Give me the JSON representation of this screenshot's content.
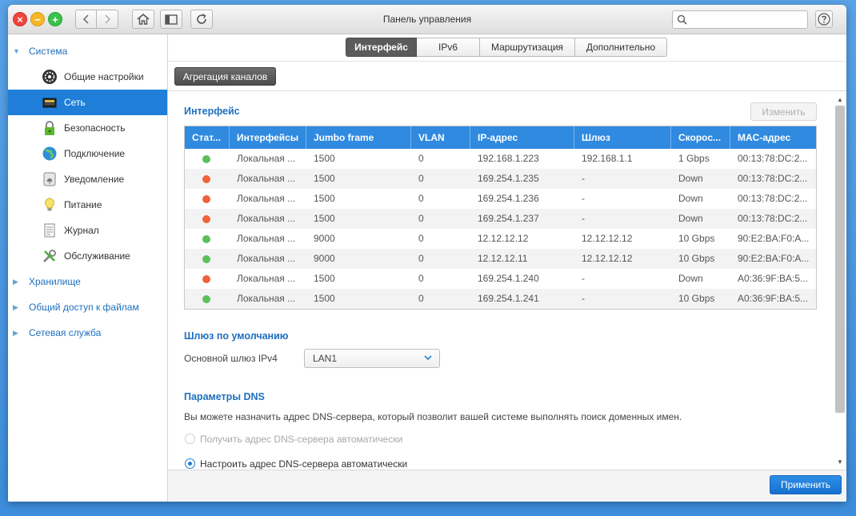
{
  "window": {
    "title": "Панель управления"
  },
  "search": {
    "placeholder": ""
  },
  "sidebar": {
    "system_label": "Система",
    "items": [
      {
        "label": "Общие настройки"
      },
      {
        "label": "Сеть"
      },
      {
        "label": "Безопасность"
      },
      {
        "label": "Подключение"
      },
      {
        "label": "Уведомление"
      },
      {
        "label": "Питание"
      },
      {
        "label": "Журнал"
      },
      {
        "label": "Обслуживание"
      }
    ],
    "sections": [
      {
        "label": "Хранилище"
      },
      {
        "label": "Общий доступ к файлам"
      },
      {
        "label": "Сетевая служба"
      }
    ]
  },
  "tabs": [
    {
      "label": "Интерфейс",
      "active": true
    },
    {
      "label": "IPv6"
    },
    {
      "label": "Маршрутизация"
    },
    {
      "label": "Дополнительно"
    }
  ],
  "toolbar": {
    "aggregation_label": "Агрегация каналов"
  },
  "interfaces": {
    "title": "Интерфейс",
    "edit_label": "Изменить",
    "columns": [
      "Стат...",
      "Интерфейсы",
      "Jumbo frame",
      "VLAN",
      "IP-адрес",
      "Шлюз",
      "Скорос...",
      "MAC-адрес"
    ],
    "rows": [
      {
        "status": "up",
        "name": "Локальная ...",
        "jumbo": "1500",
        "vlan": "0",
        "ip": "192.168.1.223",
        "gw": "192.168.1.1",
        "speed": "1 Gbps",
        "mac": "00:13:78:DC:2..."
      },
      {
        "status": "down",
        "name": "Локальная ...",
        "jumbo": "1500",
        "vlan": "0",
        "ip": "169.254.1.235",
        "gw": "-",
        "speed": "Down",
        "mac": "00:13:78:DC:2..."
      },
      {
        "status": "down",
        "name": "Локальная ...",
        "jumbo": "1500",
        "vlan": "0",
        "ip": "169.254.1.236",
        "gw": "-",
        "speed": "Down",
        "mac": "00:13:78:DC:2..."
      },
      {
        "status": "down",
        "name": "Локальная ...",
        "jumbo": "1500",
        "vlan": "0",
        "ip": "169.254.1.237",
        "gw": "-",
        "speed": "Down",
        "mac": "00:13:78:DC:2..."
      },
      {
        "status": "up",
        "name": "Локальная ...",
        "jumbo": "9000",
        "vlan": "0",
        "ip": "12.12.12.12",
        "gw": "12.12.12.12",
        "speed": "10 Gbps",
        "mac": "90:E2:BA:F0:A..."
      },
      {
        "status": "up",
        "name": "Локальная ...",
        "jumbo": "9000",
        "vlan": "0",
        "ip": "12.12.12.11",
        "gw": "12.12.12.12",
        "speed": "10 Gbps",
        "mac": "90:E2:BA:F0:A..."
      },
      {
        "status": "down",
        "name": "Локальная ...",
        "jumbo": "1500",
        "vlan": "0",
        "ip": "169.254.1.240",
        "gw": "-",
        "speed": "Down",
        "mac": "A0:36:9F:BA:5..."
      },
      {
        "status": "up",
        "name": "Локальная ...",
        "jumbo": "1500",
        "vlan": "0",
        "ip": "169.254.1.241",
        "gw": "-",
        "speed": "10 Gbps",
        "mac": "A0:36:9F:BA:5..."
      }
    ]
  },
  "gateway": {
    "title": "Шлюз по умолчанию",
    "ipv4_label": "Основной шлюз IPv4",
    "ipv4_value": "LAN1"
  },
  "dns": {
    "title": "Параметры DNS",
    "description": "Вы можете назначить адрес DNS-сервера, который позволит вашей системе выполнять поиск доменных имен.",
    "option_auto": "Получить адрес DNS-сервера автоматически",
    "option_manual": "Настроить адрес DNS-сервера автоматически"
  },
  "footer": {
    "apply_label": "Применить"
  },
  "colors": {
    "accent": "#1f7fd8",
    "header": "#2f8ae0",
    "status_up": "#5cc05a",
    "status_down": "#f0623a"
  }
}
